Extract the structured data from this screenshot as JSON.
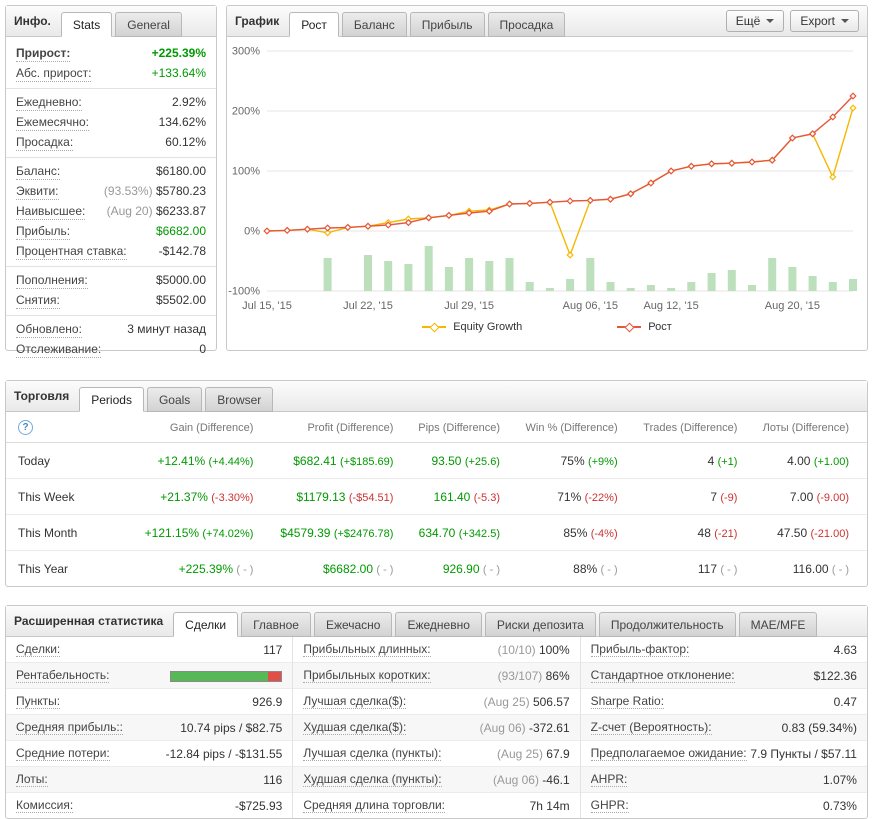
{
  "colors": {
    "green": "#009a00",
    "red": "#cc3333",
    "gray": "#999999",
    "profit_green": "#56b856",
    "profit_red": "#e05048",
    "equity_line": "#f5b800",
    "growth_line": "#e4573d",
    "volume_bar": "#bcdfbc"
  },
  "info": {
    "title": "Инфо.",
    "tabs": [
      {
        "label": "Stats",
        "active": true
      },
      {
        "label": "General",
        "active": false
      }
    ],
    "groups": [
      {
        "rows": [
          {
            "label": "Прирост:",
            "value": "+225.39%",
            "color": "green",
            "bold": true
          },
          {
            "label": "Абс. прирост:",
            "value": "+133.64%",
            "color": "green"
          }
        ]
      },
      {
        "rows": [
          {
            "label": "Ежедневно:",
            "value": "2.92%"
          },
          {
            "label": "Ежемесячно:",
            "value": "134.62%"
          },
          {
            "label": "Просадка:",
            "value": "60.12%"
          }
        ]
      },
      {
        "rows": [
          {
            "label": "Баланс:",
            "value": "$6180.00"
          },
          {
            "label": "Эквити:",
            "prefix": "(93.53%)",
            "value": "$5780.23"
          },
          {
            "label": "Наивысшее:",
            "prefix": "(Aug 20)",
            "value": "$6233.87"
          },
          {
            "label": "Прибыль:",
            "value": "$6682.00",
            "color": "green"
          },
          {
            "label": "Процентная ставка:",
            "value": "-$142.78"
          }
        ]
      },
      {
        "rows": [
          {
            "label": "Пополнения:",
            "value": "$5000.00"
          },
          {
            "label": "Снятия:",
            "value": "$5502.00"
          }
        ]
      },
      {
        "rows": [
          {
            "label": "Обновлено:",
            "value": "3 минут назад"
          },
          {
            "label": "Отслеживание:",
            "value": "0"
          }
        ]
      }
    ]
  },
  "chart": {
    "title": "График",
    "tabs": [
      {
        "label": "Рост",
        "active": true
      },
      {
        "label": "Баланс",
        "active": false
      },
      {
        "label": "Прибыль",
        "active": false
      },
      {
        "label": "Просадка",
        "active": false
      }
    ],
    "more_label": "Ещё",
    "export_label": "Export"
  },
  "chart_data": {
    "type": "line",
    "title": "Рост",
    "ylim": [
      -100,
      300
    ],
    "y_ticks": [
      300,
      200,
      100,
      0,
      -100
    ],
    "grid": true,
    "legend_position": "bottom",
    "x": [
      "Jul 15",
      "Jul 16",
      "Jul 17",
      "Jul 20",
      "Jul 21",
      "Jul 22",
      "Jul 23",
      "Jul 24",
      "Jul 27",
      "Jul 28",
      "Jul 29",
      "Jul 30",
      "Jul 31",
      "Aug 03",
      "Aug 04",
      "Aug 05",
      "Aug 06",
      "Aug 07",
      "Aug 10",
      "Aug 11",
      "Aug 12",
      "Aug 13",
      "Aug 14",
      "Aug 17",
      "Aug 18",
      "Aug 19",
      "Aug 20",
      "Aug 21",
      "Aug 24",
      "Aug 25"
    ],
    "x_ticks": [
      {
        "index": 0,
        "label": "Jul 15, '15"
      },
      {
        "index": 5,
        "label": "Jul 22, '15"
      },
      {
        "index": 10,
        "label": "Jul 29, '15"
      },
      {
        "index": 16,
        "label": "Aug 06, '15"
      },
      {
        "index": 20,
        "label": "Aug 12, '15"
      },
      {
        "index": 26,
        "label": "Aug 20, '15"
      }
    ],
    "series": [
      {
        "name": "Equity Growth",
        "color": "#f5b800",
        "values": [
          0,
          1,
          3,
          -3,
          6,
          8,
          14,
          20,
          22,
          26,
          33,
          35,
          45,
          46,
          48,
          -40,
          51,
          53,
          62,
          80,
          100,
          108,
          112,
          113,
          115,
          118,
          155,
          162,
          90,
          205
        ]
      },
      {
        "name": "Рост",
        "color": "#e4573d",
        "values": [
          0,
          1,
          3,
          5,
          6,
          8,
          10,
          14,
          22,
          26,
          30,
          33,
          45,
          46,
          48,
          50,
          51,
          53,
          62,
          80,
          100,
          108,
          112,
          113,
          115,
          118,
          155,
          162,
          190,
          225
        ]
      }
    ],
    "bars": {
      "name": "volume",
      "color": "#bcdfbc",
      "baseline": -100,
      "tops": [
        null,
        null,
        null,
        -45,
        null,
        -40,
        -50,
        -55,
        -25,
        -60,
        -45,
        -50,
        -45,
        -85,
        -95,
        -80,
        -45,
        -85,
        -95,
        -90,
        -95,
        -85,
        -70,
        -65,
        -90,
        -45,
        -60,
        -75,
        -85,
        -80
      ]
    }
  },
  "trading": {
    "title": "Торговля",
    "tabs": [
      {
        "label": "Periods",
        "active": true
      },
      {
        "label": "Goals",
        "active": false
      },
      {
        "label": "Browser",
        "active": false
      }
    ],
    "help_icon": "?",
    "columns": [
      "Gain (Difference)",
      "Profit (Difference)",
      "Pips (Difference)",
      "Win % (Difference)",
      "Trades (Difference)",
      "Лоты (Difference)"
    ],
    "rows": [
      {
        "period": "Today",
        "cells": [
          {
            "main": "+12.41%",
            "main_color": "green",
            "diff": "(+4.44%)",
            "diff_color": "green"
          },
          {
            "main": "$682.41",
            "main_color": "green",
            "diff": "(+$185.69)",
            "diff_color": "green"
          },
          {
            "main": "93.50",
            "main_color": "green",
            "diff": "(+25.6)",
            "diff_color": "green"
          },
          {
            "main": "75%",
            "main_color": "dark",
            "diff": "(+9%)",
            "diff_color": "green"
          },
          {
            "main": "4",
            "main_color": "dark",
            "diff": "(+1)",
            "diff_color": "green"
          },
          {
            "main": "4.00",
            "main_color": "dark",
            "diff": "(+1.00)",
            "diff_color": "green"
          }
        ]
      },
      {
        "period": "This Week",
        "cells": [
          {
            "main": "+21.37%",
            "main_color": "green",
            "diff": "(-3.30%)",
            "diff_color": "red"
          },
          {
            "main": "$1179.13",
            "main_color": "green",
            "diff": "(-$54.51)",
            "diff_color": "red"
          },
          {
            "main": "161.40",
            "main_color": "green",
            "diff": "(-5.3)",
            "diff_color": "red"
          },
          {
            "main": "71%",
            "main_color": "dark",
            "diff": "(-22%)",
            "diff_color": "red"
          },
          {
            "main": "7",
            "main_color": "dark",
            "diff": "(-9)",
            "diff_color": "red"
          },
          {
            "main": "7.00",
            "main_color": "dark",
            "diff": "(-9.00)",
            "diff_color": "red"
          }
        ]
      },
      {
        "period": "This Month",
        "cells": [
          {
            "main": "+121.15%",
            "main_color": "green",
            "diff": "(+74.02%)",
            "diff_color": "green"
          },
          {
            "main": "$4579.39",
            "main_color": "green",
            "diff": "(+$2476.78)",
            "diff_color": "green"
          },
          {
            "main": "634.70",
            "main_color": "green",
            "diff": "(+342.5)",
            "diff_color": "green"
          },
          {
            "main": "85%",
            "main_color": "dark",
            "diff": "(-4%)",
            "diff_color": "red"
          },
          {
            "main": "48",
            "main_color": "dark",
            "diff": "(-21)",
            "diff_color": "red"
          },
          {
            "main": "47.50",
            "main_color": "dark",
            "diff": "(-21.00)",
            "diff_color": "red"
          }
        ]
      },
      {
        "period": "This Year",
        "cells": [
          {
            "main": "+225.39%",
            "main_color": "green",
            "diff": "( - )",
            "diff_color": "gray"
          },
          {
            "main": "$6682.00",
            "main_color": "green",
            "diff": "( - )",
            "diff_color": "gray"
          },
          {
            "main": "926.90",
            "main_color": "green",
            "diff": "( - )",
            "diff_color": "gray"
          },
          {
            "main": "88%",
            "main_color": "dark",
            "diff": "( - )",
            "diff_color": "gray"
          },
          {
            "main": "117",
            "main_color": "dark",
            "diff": "( - )",
            "diff_color": "gray"
          },
          {
            "main": "116.00",
            "main_color": "dark",
            "diff": "( - )",
            "diff_color": "gray"
          }
        ]
      }
    ]
  },
  "advanced": {
    "title": "Расширенная статистика",
    "tabs": [
      {
        "label": "Сделки",
        "active": true
      },
      {
        "label": "Главное",
        "active": false
      },
      {
        "label": "Ежечасно",
        "active": false
      },
      {
        "label": "Ежедневно",
        "active": false
      },
      {
        "label": "Риски депозита",
        "active": false
      },
      {
        "label": "Продолжительность",
        "active": false
      },
      {
        "label": "MAE/MFE",
        "active": false
      }
    ],
    "columns": [
      [
        {
          "label": "Сделки:",
          "value": "117"
        },
        {
          "label": "Рентабельность:",
          "type": "bar",
          "win_pct": 88,
          "loss_pct": 12
        },
        {
          "label": "Пункты:",
          "value": "926.9"
        },
        {
          "label": "Средняя прибыль::",
          "value": "10.74 pips / $82.75"
        },
        {
          "label": "Средние потери:",
          "value": "-12.84 pips / -$131.55"
        },
        {
          "label": "Лоты:",
          "value": "116"
        },
        {
          "label": "Комиссия:",
          "value": "-$725.93"
        }
      ],
      [
        {
          "label": "Прибыльных длинных:",
          "prefix": "(10/10)",
          "value": "100%"
        },
        {
          "label": "Прибыльных коротких:",
          "prefix": "(93/107)",
          "value": "86%"
        },
        {
          "label": "Лучшая сделка($):",
          "prefix": "(Aug 25)",
          "value": "506.57"
        },
        {
          "label": "Худшая сделка($):",
          "prefix": "(Aug 06)",
          "value": "-372.61"
        },
        {
          "label": "Лучшая сделка (пункты):",
          "prefix": "(Aug 25)",
          "value": "67.9"
        },
        {
          "label": "Худшая сделка (пункты):",
          "prefix": "(Aug 06)",
          "value": "-46.1"
        },
        {
          "label": "Средняя длина торговли:",
          "value": "7h 14m"
        }
      ],
      [
        {
          "label": "Прибыль-фактор:",
          "value": "4.63"
        },
        {
          "label": "Стандартное отклонение:",
          "value": "$122.36"
        },
        {
          "label": "Sharpe Ratio:",
          "value": "0.47"
        },
        {
          "label": "Z-счет (Вероятность):",
          "value": "0.83 (59.34%)"
        },
        {
          "label": "Предполагаемое ожидание:",
          "value": "7.9 Пункты / $57.11"
        },
        {
          "label": "AHPR:",
          "value": "1.07%"
        },
        {
          "label": "GHPR:",
          "value": "0.73%"
        }
      ]
    ]
  }
}
